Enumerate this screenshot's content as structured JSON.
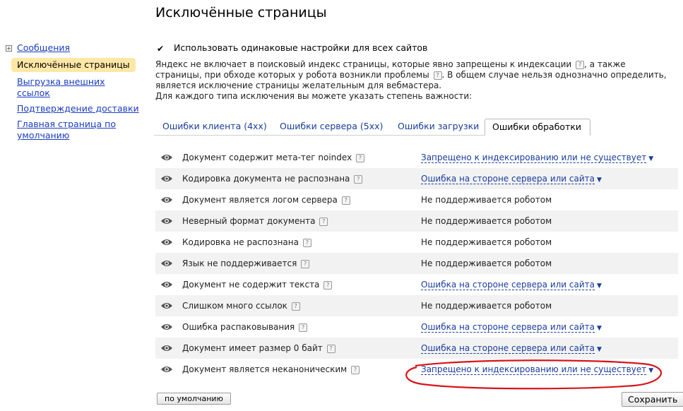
{
  "page": {
    "title": "Исключённые страницы"
  },
  "sidebar": {
    "items": [
      {
        "label": "Сообщения"
      },
      {
        "label": "Исключённые страницы"
      },
      {
        "label": "Выгрузка внешних ссылок"
      },
      {
        "label": "Подтверждение доставки"
      },
      {
        "label": "Главная страница по умолчанию"
      }
    ]
  },
  "settings": {
    "same_settings_label": "Использовать одинаковые настройки для всех сайтов",
    "same_settings_checked": true
  },
  "description": {
    "part1": "Яндекс не включает в поисковый индекс страницы, которые явно запрещены к индексации",
    "part2": ", а также страницы, при обходе которых у робота возникли проблемы",
    "part3": ". В общем случае нельзя однозначно определить, является исключение страницы желательным для вебмастера.",
    "part4": "Для каждого типа исключения вы можете указать степень важности:"
  },
  "help_mark": "?",
  "tabs": [
    {
      "label": "Ошибки клиента (4xx)"
    },
    {
      "label": "Ошибки сервера (5xx)"
    },
    {
      "label": "Ошибки загрузки"
    },
    {
      "label": "Ошибки обработки"
    }
  ],
  "rows": [
    {
      "label": "Документ содержит мета-тег noindex",
      "status": "Запрещено к индексированию или не существует"
    },
    {
      "label": "Кодировка документа не распознана",
      "status": "Ошибка на стороне сервера или сайта"
    },
    {
      "label": "Документ является логом сервера",
      "status": "Не поддерживается роботом"
    },
    {
      "label": "Неверный формат документа",
      "status": "Не поддерживается роботом"
    },
    {
      "label": "Кодировка не распознана",
      "status": "Не поддерживается роботом"
    },
    {
      "label": "Язык не поддерживается",
      "status": "Не поддерживается роботом"
    },
    {
      "label": "Документ не содержит текста",
      "status": "Ошибка на стороне сервера или сайта"
    },
    {
      "label": "Слишком много ссылок",
      "status": "Не поддерживается роботом"
    },
    {
      "label": "Ошибка распаковывания",
      "status": "Ошибка на стороне сервера или сайта"
    },
    {
      "label": "Документ имеет размер 0 байт",
      "status": "Ошибка на стороне сервера или сайта"
    },
    {
      "label": "Документ является неканоническим",
      "status": "Запрещено к индексированию или не существует"
    }
  ],
  "dropdown_arrow": "▼",
  "buttons": {
    "default_label": "по умолчанию",
    "save_label": "Сохранить"
  },
  "colors": {
    "accent_link": "#1a3d9c",
    "active_sidebar_bg": "#ffe7a6",
    "annotation_red": "#d8141b"
  }
}
